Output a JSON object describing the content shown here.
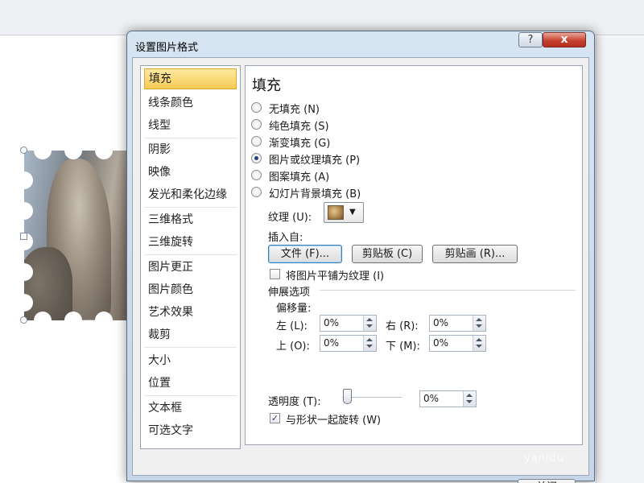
{
  "dialog": {
    "title": "设置图片格式",
    "help_label": "?",
    "close_label": "x",
    "close_button_label": "关闭"
  },
  "categories": [
    {
      "label": "填充",
      "selected": true
    },
    {
      "label": "线条颜色"
    },
    {
      "label": "线型"
    },
    {
      "label": "阴影"
    },
    {
      "label": "映像"
    },
    {
      "label": "发光和柔化边缘"
    },
    {
      "label": "三维格式"
    },
    {
      "label": "三维旋转"
    },
    {
      "label": "图片更正"
    },
    {
      "label": "图片颜色"
    },
    {
      "label": "艺术效果"
    },
    {
      "label": "裁剪"
    },
    {
      "label": "大小"
    },
    {
      "label": "位置"
    },
    {
      "label": "文本框"
    },
    {
      "label": "可选文字"
    }
  ],
  "fill": {
    "title": "填充",
    "options": [
      {
        "label": "无填充 (N)",
        "checked": false
      },
      {
        "label": "纯色填充 (S)",
        "checked": false
      },
      {
        "label": "渐变填充 (G)",
        "checked": false
      },
      {
        "label": "图片或纹理填充 (P)",
        "checked": true
      },
      {
        "label": "图案填充 (A)",
        "checked": false
      },
      {
        "label": "幻灯片背景填充 (B)",
        "checked": false
      }
    ],
    "texture_label": "纹理 (U):",
    "insert_from_label": "插入自:",
    "file_button": "文件 (F)...",
    "clipboard_button": "剪贴板 (C)",
    "clipart_button": "剪贴画 (R)...",
    "tile_label": "将图片平铺为纹理 (I)",
    "tile_checked": false,
    "stretch_options_label": "伸展选项",
    "offsets_label": "偏移量:",
    "left_label": "左 (L):",
    "left_value": "0%",
    "right_label": "右 (R):",
    "right_value": "0%",
    "top_label": "上 (O):",
    "top_value": "0%",
    "bottom_label": "下 (M):",
    "bottom_value": "0%",
    "transparency_label": "透明度 (T):",
    "transparency_value": "0%",
    "rotate_label": "与形状一起旋转 (W)",
    "rotate_checked": true
  },
  "watermark": "yanidu"
}
